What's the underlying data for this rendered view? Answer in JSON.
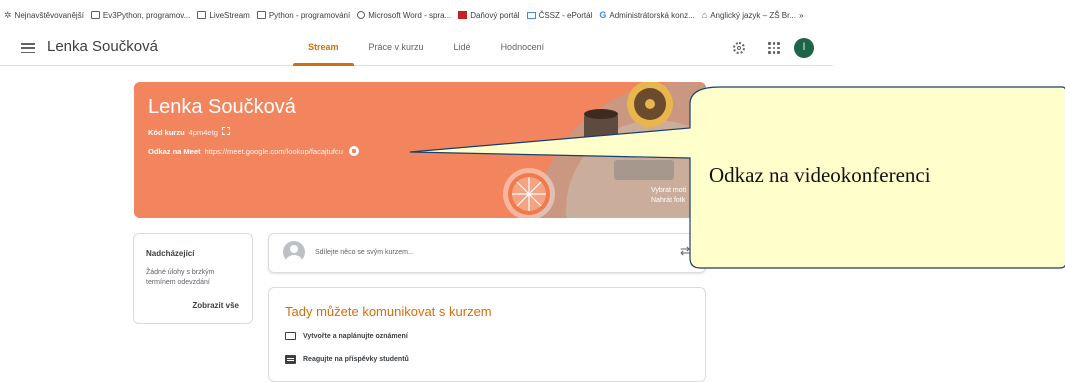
{
  "bookmarks": [
    {
      "label": "Nejnavštěvovanější",
      "icon": "star-icon"
    },
    {
      "label": "Ev3Python, programov...",
      "icon": "folder-icon"
    },
    {
      "label": "LiveStream",
      "icon": "folder-icon"
    },
    {
      "label": "Python - programování",
      "icon": "folder-icon"
    },
    {
      "label": "Microsoft Word - spra...",
      "icon": "globe-icon"
    },
    {
      "label": "Daňový portál",
      "icon": "red-square-icon"
    },
    {
      "label": "ČSSZ - ePortál",
      "icon": "mail-icon"
    },
    {
      "label": "Administrátorská konz...",
      "icon": "google-icon"
    },
    {
      "label": "Anglický jazyk – ZŠ Br...",
      "icon": "building-icon"
    }
  ],
  "bookmarks_more": "»",
  "header": {
    "class_title": "Lenka Součková",
    "tabs": [
      "Stream",
      "Práce v kurzu",
      "Lidé",
      "Hodnocení"
    ],
    "active_tab": "Stream",
    "avatar_initial": "l"
  },
  "banner": {
    "name": "Lenka Součková",
    "code_label": "Kód kurzu",
    "code_value": "4pm4etg",
    "meet_label": "Odkaz na Meet",
    "meet_value": "https://meet.google.com/lookup/facajtufcu",
    "hint_line1": "Vybrat moti",
    "hint_line2": "Nahrát fotk",
    "color": "#f3855e"
  },
  "upcoming": {
    "title": "Nadcházející",
    "text": "Žádné úlohy s brzkým termínem odevzdání",
    "link": "Zobrazit vše"
  },
  "share": {
    "placeholder": "Sdílejte něco se svým kurzem..."
  },
  "communicate": {
    "title": "Tady můžete komunikovat s kurzem",
    "items": [
      "Vytvořte a naplánujte oznámení",
      "Reagujte na příspěvky studentů"
    ]
  },
  "callout": {
    "text": "Odkaz na videokonferenci",
    "fill": "#ffffcc"
  },
  "accent": "#d56e0c"
}
